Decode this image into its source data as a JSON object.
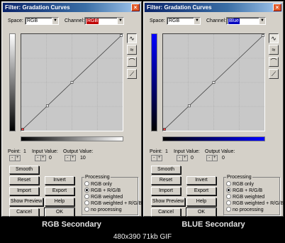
{
  "dialogs": [
    {
      "title": "Filter: Gradation Curves",
      "space_label": "Space:",
      "space_value": "RGB",
      "channel_label": "Channel:",
      "channel_value": "RGB",
      "channel_color": "#c00000",
      "gradient_top": "#ffffff",
      "gradient_bottom": "#000000",
      "curve_points": [
        [
          0,
          0
        ],
        [
          0.25,
          0.25
        ],
        [
          0.5,
          0.5
        ],
        [
          1,
          1
        ]
      ],
      "point_label": "Point:",
      "point_value": "1",
      "input_label": "Input Value:",
      "input_value": "0",
      "output_label": "Output Value:",
      "output_value": "10",
      "caption": "RGB Secondary"
    },
    {
      "title": "Filter: Gradation Curves",
      "space_label": "Space:",
      "space_value": "RGB",
      "channel_label": "Channel:",
      "channel_value": "Blue",
      "channel_color": "#0000c0",
      "gradient_top": "#0000ff",
      "gradient_bottom": "#000000",
      "curve_points": [
        [
          0,
          0
        ],
        [
          0.25,
          0.25
        ],
        [
          0.5,
          0.5
        ],
        [
          1,
          1
        ]
      ],
      "point_label": "Point:",
      "point_value": "1",
      "input_label": "Input Value:",
      "input_value": "0",
      "output_label": "Output Value:",
      "output_value": "0",
      "caption": "BLUE Secondary"
    }
  ],
  "buttons": {
    "smooth": "Smooth",
    "reset": "Reset",
    "invert": "Invert",
    "import": "Import",
    "export": "Export",
    "show_preview": "Show Preview",
    "help": "Help",
    "cancel": "Cancel",
    "ok": "OK"
  },
  "processing": {
    "title": "Processing",
    "options": [
      "RGB only",
      "RGB + R/G/B",
      "RGB weighted",
      "RGB weighted + R/G/B",
      "no processing"
    ],
    "selected_index": 1
  },
  "icons": {
    "close": "close-icon",
    "tools": [
      "curve-tool-icon",
      "freehand-tool-icon",
      "smooth-tool-icon",
      "linear-tool-icon"
    ]
  },
  "image_info": "480x390 71kb GIF"
}
